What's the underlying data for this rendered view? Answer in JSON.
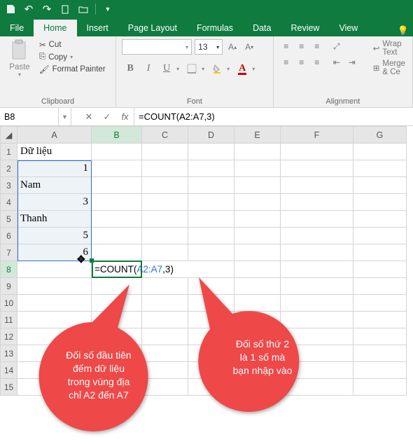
{
  "qat": {
    "save": "💾",
    "undo": "↶",
    "redo": "↷",
    "new": "🗋",
    "open": "📂"
  },
  "tabs": [
    "File",
    "Home",
    "Insert",
    "Page Layout",
    "Formulas",
    "Data",
    "Review",
    "View"
  ],
  "active_tab": "Home",
  "ribbon": {
    "clipboard": {
      "paste": "Paste",
      "cut": "Cut",
      "copy": "Copy",
      "painter": "Format Painter",
      "label": "Clipboard"
    },
    "font": {
      "size": "13",
      "bold": "B",
      "italic": "I",
      "underline": "U",
      "label": "Font"
    },
    "alignment": {
      "wrap": "Wrap Text",
      "merge": "Merge & Ce",
      "label": "Alignment"
    }
  },
  "name_box": "B8",
  "formula": "=COUNT(A2:A7,3)",
  "columns": [
    "A",
    "B",
    "C",
    "D",
    "E",
    "F",
    "G"
  ],
  "cells": {
    "A1": "Dữ liệu",
    "A2": "1",
    "A3": "Nam",
    "A4": "3",
    "A5": "Thanh",
    "A6": "5",
    "A7": "6"
  },
  "b8_display": {
    "prefix": "=COUNT(",
    "range": "A2:A7",
    "comma": ",",
    "arg2": "3",
    "suffix": ")"
  },
  "callout1": "Đối số đầu tiên\nđếm dữ liệu\ntrong vùng địa\nchỉ A2 đến A7",
  "callout2": "Đối số thứ 2\nlà 1 số mà\nbạn nhập vào"
}
